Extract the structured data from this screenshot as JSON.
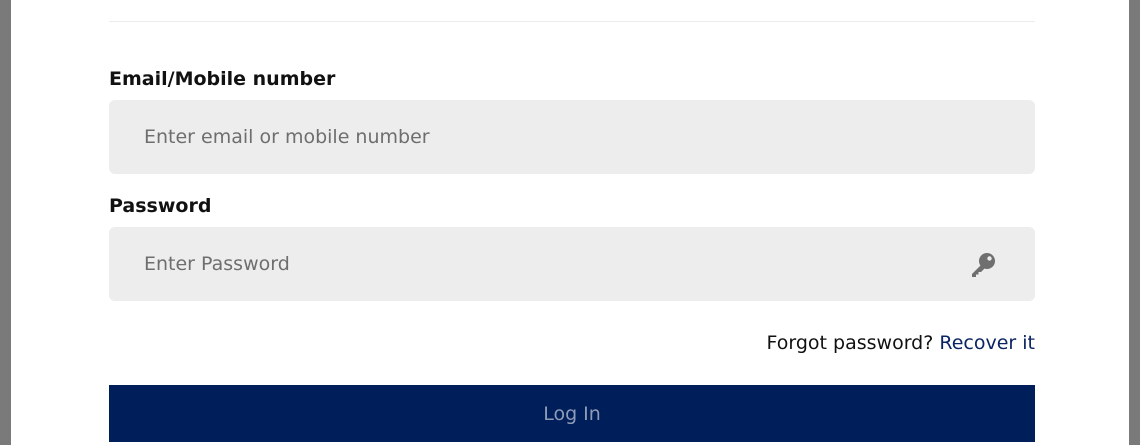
{
  "form": {
    "email_label": "Email/Mobile number",
    "email_placeholder": "Enter email or mobile number",
    "email_value": "",
    "password_label": "Password",
    "password_placeholder": "Enter Password",
    "password_value": "",
    "password_icon": "key-icon",
    "forgot_text": "Forgot password?",
    "recover_link": "Recover it",
    "login_label": "Log In"
  },
  "colors": {
    "overlay": "#7a7a7a",
    "input_background": "#ededed",
    "link": "#0b2463",
    "primary_button": "#001e5a",
    "primary_button_text": "#8e9bb7"
  }
}
